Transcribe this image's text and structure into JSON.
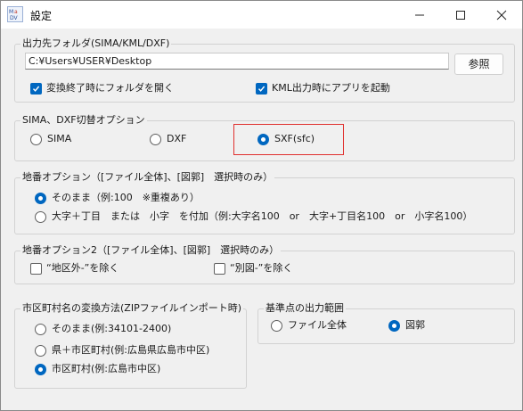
{
  "window": {
    "title": "設定",
    "icon_text": "SIMA DXF"
  },
  "output_folder": {
    "group_label": "出力先フォルダ(SIMA/KML/DXF)",
    "path_value": "C:¥Users¥USER¥Desktop",
    "browse_label": "参照",
    "open_folder_label": "変換終了時にフォルダを開く",
    "open_folder_checked": true,
    "kml_app_label": "KML出力時にアプリを起動",
    "kml_app_checked": true
  },
  "sima_dxf": {
    "group_label": "SIMA、DXF切替オプション",
    "options": [
      {
        "label": "SIMA",
        "selected": false
      },
      {
        "label": "DXF",
        "selected": false
      },
      {
        "label": "SXF(sfc)",
        "selected": true
      }
    ]
  },
  "lot_option": {
    "group_label": "地番オプション（[ファイル全体]、[図郭]　選択時のみ）",
    "options": [
      {
        "label": "そのまま（例:100　※重複あり）",
        "selected": true
      },
      {
        "label": "大字＋丁目　または　小字　を付加（例:大字名100　or　大字+丁目名100　or　小字名100）",
        "selected": false
      }
    ]
  },
  "lot_option2": {
    "group_label": "地番オプション2（[ファイル全体]、[図郭]　選択時のみ）",
    "exclude_outside_label": "“地区外-”を除く",
    "exclude_outside_checked": false,
    "exclude_separate_label": "“別図-”を除く",
    "exclude_separate_checked": false
  },
  "municipality": {
    "group_label": "市区町村名の変換方法(ZIPファイルインポート時)",
    "options": [
      {
        "label": "そのまま(例:34101-2400)",
        "selected": false
      },
      {
        "label": "県＋市区町村(例:広島県広島市中区)",
        "selected": false
      },
      {
        "label": "市区町村(例:広島市中区)",
        "selected": true
      }
    ]
  },
  "reference_point": {
    "group_label": "基準点の出力範囲",
    "options": [
      {
        "label": "ファイル全体",
        "selected": false
      },
      {
        "label": "図郭",
        "selected": true
      }
    ]
  },
  "colors": {
    "accent": "#0067c0",
    "highlight_border": "#e0302e"
  }
}
